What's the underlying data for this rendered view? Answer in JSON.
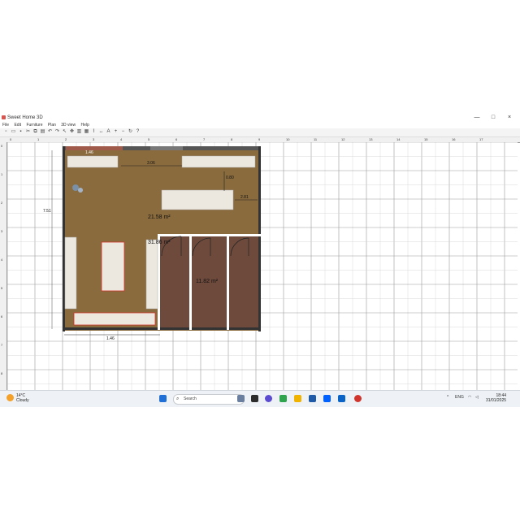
{
  "window": {
    "title": "Sweet Home 3D",
    "minimize": "—",
    "maximize": "□",
    "close": "×"
  },
  "menu": [
    "File",
    "Edit",
    "Furniture",
    "Plan",
    "3D view",
    "Help"
  ],
  "toolbar_icons": [
    "new-icon",
    "open-icon",
    "save-icon",
    "cut-icon",
    "copy-icon",
    "paste-icon",
    "undo-icon",
    "redo-icon",
    "select-icon",
    "pan-icon",
    "create-walls-icon",
    "create-rooms-icon",
    "create-polylines-icon",
    "create-dimensions-icon",
    "add-text-icon",
    "zoom-in-icon",
    "zoom-out-icon",
    "rotate-icon",
    "help-icon"
  ],
  "ruler": {
    "h_ticks": [
      "0",
      "1",
      "2",
      "3",
      "4",
      "5",
      "6",
      "7",
      "8",
      "9",
      "10",
      "11",
      "12",
      "13",
      "14",
      "15",
      "16",
      "17"
    ],
    "v_ticks": [
      "0",
      "1",
      "2",
      "3",
      "4",
      "5",
      "6",
      "7",
      "8"
    ]
  },
  "plan": {
    "dimensions": {
      "top_left": "1.46",
      "top_mid": "3.06",
      "right_vertical": "0.80",
      "right_horizontal": "2.81",
      "left_vertical": "7.51",
      "bottom": "1.46"
    },
    "rooms": {
      "main_area": "21.58 m²",
      "bath_area": "31.86 m²",
      "storage_area": "11.82 m²"
    },
    "colors": {
      "floor_wood": "#8a6b3e",
      "floor_tile": "#6e4a3c",
      "wall": "#333333",
      "furniture": "#ece8e0",
      "highlight": "#d0342c"
    }
  },
  "taskbar": {
    "weather_temp": "14°C",
    "weather_desc": "Cloudy",
    "search_placeholder": "Search",
    "language": "ENG",
    "time": "18:44",
    "date": "31/01/2025"
  }
}
